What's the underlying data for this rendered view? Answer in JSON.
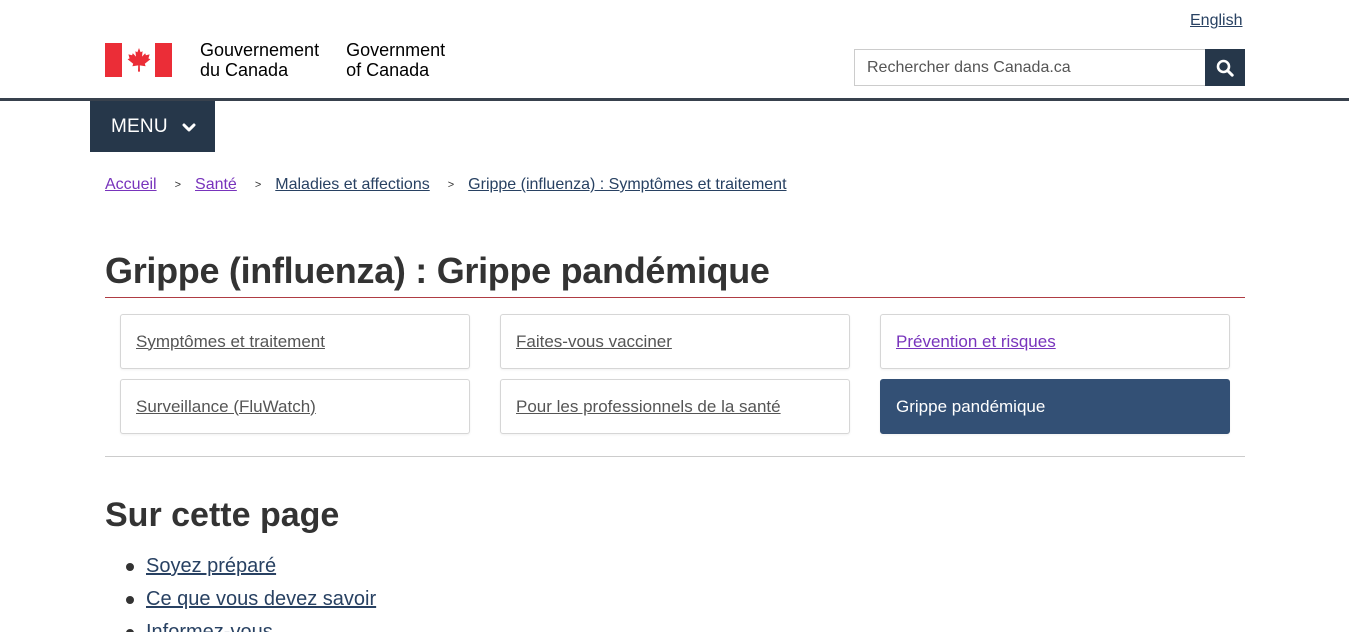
{
  "header": {
    "language_toggle": "English",
    "brand": {
      "fr_line1": "Gouvernement",
      "fr_line2": "du Canada",
      "en_line1": "Government",
      "en_line2": "of Canada",
      "flag_icon": "canada-flag-icon"
    },
    "search": {
      "placeholder": "Rechercher dans Canada.ca",
      "button_icon": "search-icon"
    },
    "menu_label": "MENU"
  },
  "breadcrumb": [
    {
      "label": "Accueil",
      "visited": true
    },
    {
      "label": "Santé",
      "visited": true
    },
    {
      "label": "Maladies et affections",
      "visited": false
    },
    {
      "label": "Grippe (influenza) : Symptômes et traitement",
      "visited": false
    }
  ],
  "breadcrumb_separator": ">",
  "page": {
    "title": "Grippe (influenza) : Grippe pandémique"
  },
  "topic_nav": [
    {
      "label": "Symptômes et traitement"
    },
    {
      "label": "Faites-vous vacciner"
    },
    {
      "label": "Prévention et risques"
    },
    {
      "label": "Surveillance (FluWatch)"
    },
    {
      "label": "Pour les professionnels de la santé"
    },
    {
      "label": "Grippe pandémique"
    }
  ],
  "on_this_page": {
    "heading": "Sur cette page",
    "items": [
      "Soyez préparé",
      "Ce que vous devez savoir",
      "Informez-vous"
    ]
  },
  "colors": {
    "primary_dark": "#26374a",
    "active_nav": "#335075",
    "link": "#284162",
    "visited_link": "#7834bc",
    "title_rule": "#af3c43",
    "flag_red": "#eb2d37"
  }
}
